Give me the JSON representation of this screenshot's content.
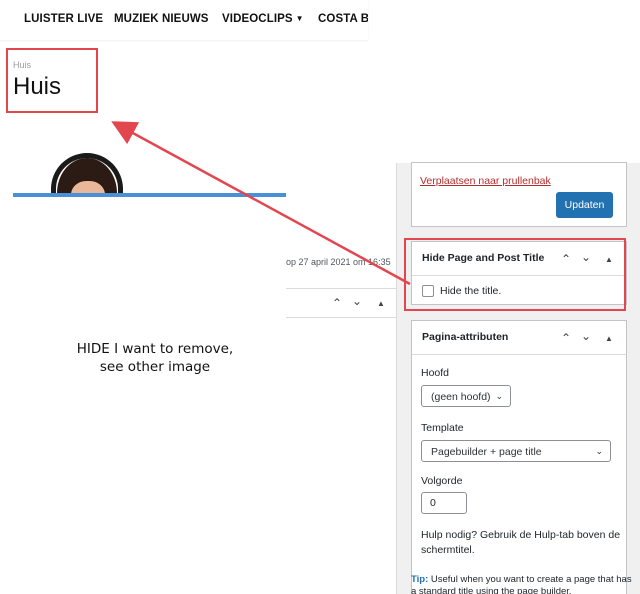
{
  "nav": {
    "items": [
      "LUISTER LIVE",
      "MUZIEK NIEUWS",
      "VIDEOCLIPS",
      "COSTA BL"
    ]
  },
  "page": {
    "breadcrumb": "Huis",
    "title": "Huis"
  },
  "editor": {
    "publish_date": "op 27 april 2021 om 16:35"
  },
  "note": {
    "line1": "HIDE I want to remove,",
    "line2": "see other image"
  },
  "publish_box": {
    "trash_label": "Verplaatsen naar prullenbak",
    "update_label": "Updaten"
  },
  "hide_title_box": {
    "title": "Hide Page and Post Title",
    "checkbox_label": "Hide the title.",
    "checked": false
  },
  "page_attributes": {
    "title": "Pagina-attributen",
    "parent_label": "Hoofd",
    "parent_value": "(geen hoofd)",
    "template_label": "Template",
    "template_value": "Pagebuilder + page title",
    "order_label": "Volgorde",
    "order_value": "0",
    "help_text": "Hulp nodig? Gebruik de Hulp-tab boven de schermtitel."
  },
  "tip": {
    "prefix": "Tip:",
    "text": "Useful when you want to create a page that has a standard title using the page builder."
  },
  "colors": {
    "annotation_red": "#e2474f",
    "wp_blue": "#2271b1",
    "trash_red": "#b32d2e"
  },
  "icons": {
    "collapse_up": "chevron-up-icon",
    "expand_down": "chevron-down-icon",
    "toggle_panel": "triangle-up-icon",
    "select_open": "chevron-down-icon"
  }
}
